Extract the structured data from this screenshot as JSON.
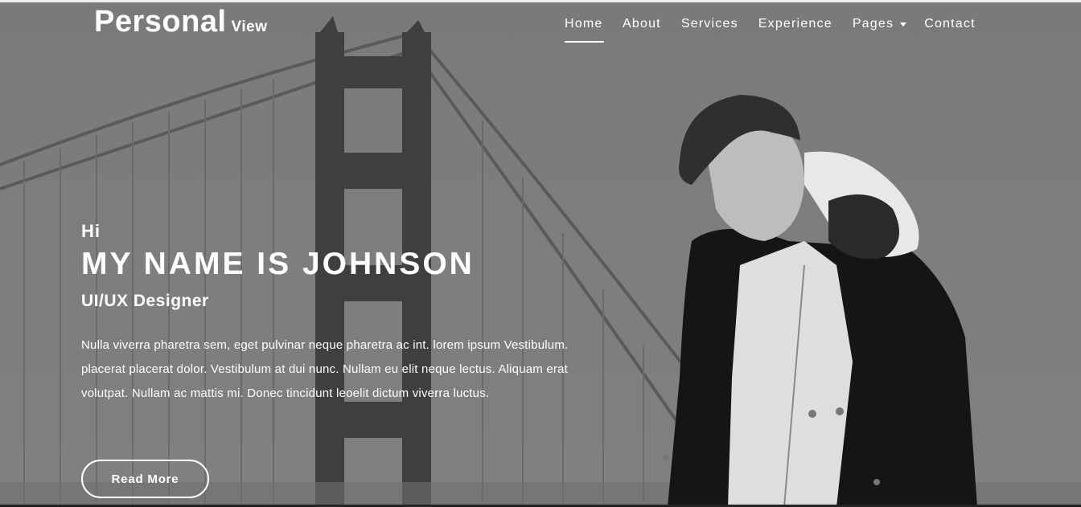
{
  "brand": {
    "main": "Personal",
    "sub": "View"
  },
  "nav": {
    "items": [
      {
        "label": "Home",
        "active": true
      },
      {
        "label": "About"
      },
      {
        "label": "Services"
      },
      {
        "label": "Experience"
      },
      {
        "label": "Pages",
        "dropdown": true
      },
      {
        "label": "Contact"
      }
    ]
  },
  "hero": {
    "greeting": "Hi",
    "title": "MY NAME IS JOHNSON",
    "role": "UI/UX Designer",
    "description": "Nulla viverra pharetra sem, eget pulvinar neque pharetra ac int. lorem ipsum Vestibulum. placerat placerat dolor. Vestibulum at dui nunc. Nullam eu elit neque lectus. Aliquam erat volutpat. Nullam ac mattis mi. Donec tincidunt leoelit dictum viverra luctus.",
    "button_label": "Read More"
  },
  "icons": {
    "dropdown": "caret-down-icon"
  },
  "colors": {
    "overlay": "#7b7b7b",
    "text": "#ffffff"
  }
}
